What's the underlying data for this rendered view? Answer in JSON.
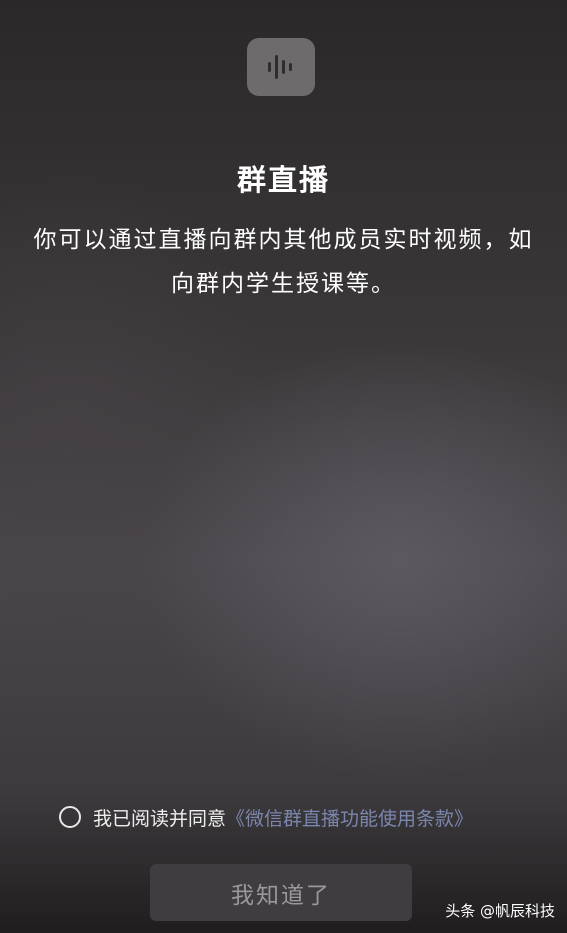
{
  "header": {
    "icon": "voice-wave-icon",
    "title": "群直播"
  },
  "content": {
    "description": "你可以通过直播向群内其他成员实时视频，如向群内学生授课等。"
  },
  "agreement": {
    "checked": false,
    "prefix": "我已阅读并同意",
    "link_text": "《微信群直播功能使用条款》"
  },
  "button": {
    "label": "我知道了"
  },
  "watermark": {
    "text": "头条 @帆辰科技"
  },
  "colors": {
    "link": "#7b86ad",
    "button_bg": "#3f3d3f",
    "button_text": "#9a989a",
    "icon_bg": "#6e6b6d"
  }
}
